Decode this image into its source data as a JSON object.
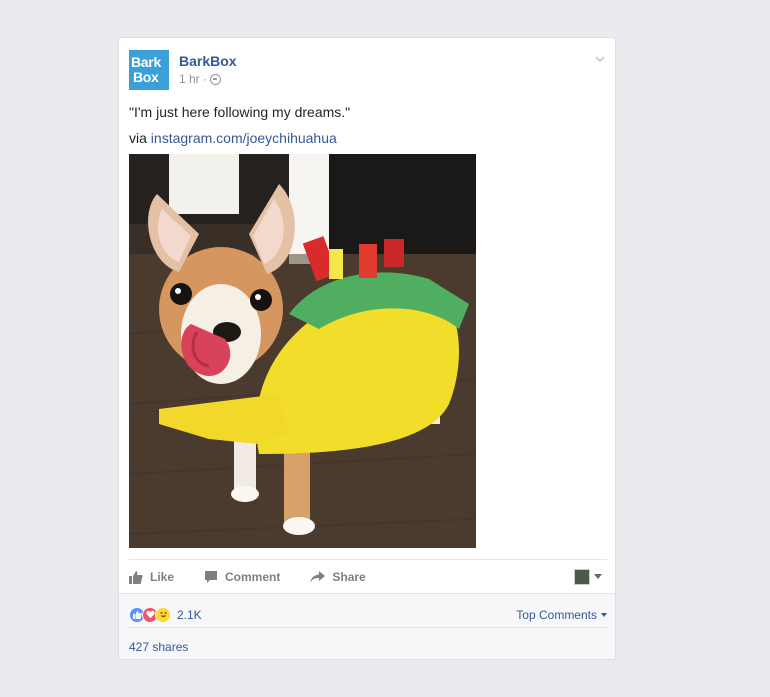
{
  "post": {
    "page_name": "BarkBox",
    "logo_line1": "Bark",
    "logo_line2": "Box",
    "timestamp": "1 hr",
    "separator": "·",
    "quote": "\"I'm just here following my dreams.\"",
    "via_prefix": "via ",
    "via_link": "instagram.com/joeychihuahua"
  },
  "actions": {
    "like": "Like",
    "comment": "Comment",
    "share": "Share"
  },
  "reactions": {
    "count": "2.1K",
    "top_comments": "Top Comments",
    "shares": "427 shares"
  },
  "colors": {
    "link": "#365899",
    "logo_bg": "#3b9fd8",
    "taco_shell": "#f4e030",
    "lettuce": "#58b86a"
  }
}
